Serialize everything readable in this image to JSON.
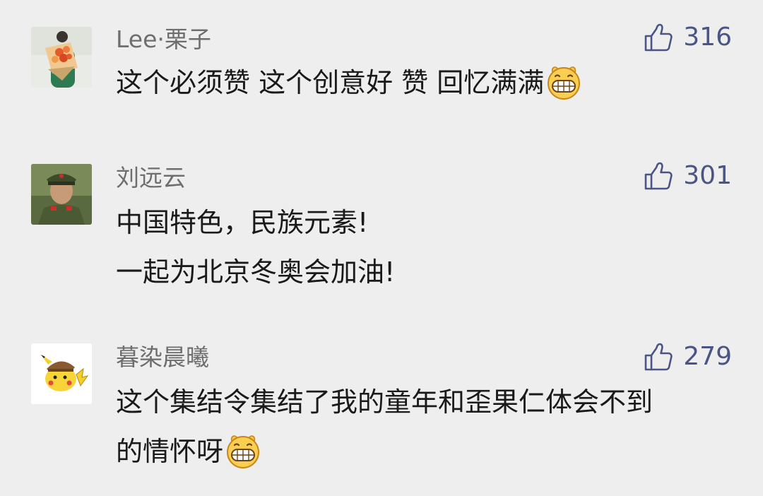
{
  "comments": [
    {
      "name": "Lee·栗子",
      "likes": "316",
      "lines": [
        "这个必须赞  这个创意好 赞 回忆满满"
      ],
      "trailing_emoji": "grin-emoji",
      "avatar": "bouquet-photo"
    },
    {
      "name": "刘远云",
      "likes": "301",
      "lines": [
        "中国特色，民族元素!",
        "一起为北京冬奥会加油!"
      ],
      "avatar": "soldier-photo"
    },
    {
      "name": "暮染晨曦",
      "likes": "279",
      "lines": [
        "这个集结令集结了我的童年和歪果仁体会不到",
        "的情怀呀"
      ],
      "trailing_emoji": "grin-emoji",
      "avatar": "pikachu-detective"
    }
  ],
  "icons": {
    "like": "thumbs-up-icon"
  },
  "colors": {
    "background": "#eeeeee",
    "name_text": "#6e6e6e",
    "body_text": "#1a1a1a",
    "like_accent": "#4a5585"
  }
}
